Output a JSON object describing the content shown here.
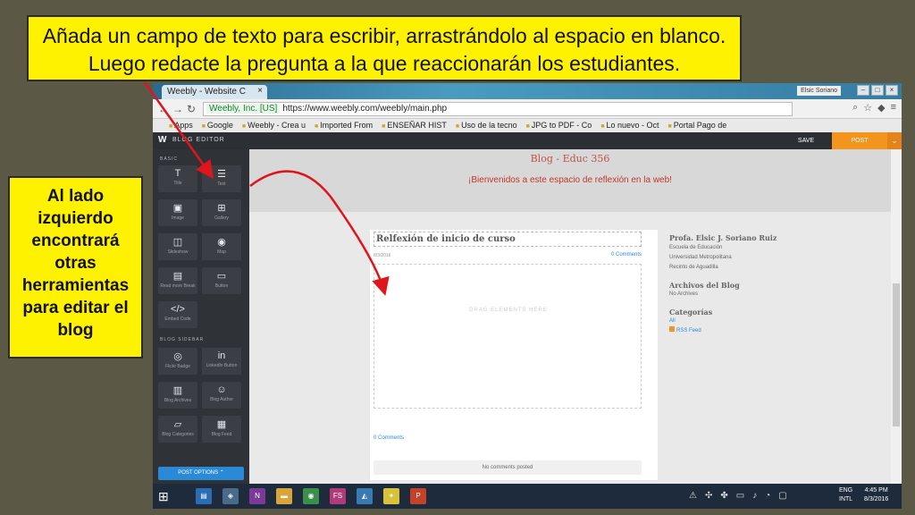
{
  "callouts": {
    "top_line1": "Añada un campo de texto para escribir, arrastrándolo al espacio en blanco.",
    "top_line2": "Luego redacte la pregunta a la que reaccionarán los estudiantes.",
    "left": "Al lado izquierdo encontrará otras herramientas para editar el blog"
  },
  "browser": {
    "tab_title": "Weebly - Website C",
    "user": "Elsic Soriano",
    "secure_label": "Weebly, Inc. [US]",
    "url": "https://www.weebly.com/weebly/main.php",
    "bookmarks": [
      "Apps",
      "Google",
      "Weebly - Crea u",
      "Imported From",
      "ENSEÑAR HIST",
      "Uso de la tecno",
      "JPG to PDF - Co",
      "Lo nuevo - Oct",
      "Portal Pago de"
    ]
  },
  "editor": {
    "title": "BLOG EDITOR",
    "save": "SAVE",
    "post": "POST",
    "sections": {
      "basic": "BASIC",
      "sidebar": "BLOG SIDEBAR"
    },
    "basic_tools": [
      {
        "label": "Title",
        "icon": "T"
      },
      {
        "label": "Text",
        "icon": "☰"
      },
      {
        "label": "Image",
        "icon": "▣"
      },
      {
        "label": "Gallery",
        "icon": "⊞"
      },
      {
        "label": "Slideshow",
        "icon": "◫"
      },
      {
        "label": "Map",
        "icon": "◉"
      },
      {
        "label": "Read more Break",
        "icon": "▤"
      },
      {
        "label": "Button",
        "icon": "▭"
      },
      {
        "label": "Embed Code",
        "icon": "</>"
      }
    ],
    "sidebar_tools": [
      {
        "label": "Flickr Badge",
        "icon": "◎"
      },
      {
        "label": "LinkedIn Button",
        "icon": "in"
      },
      {
        "label": "Blog Archives",
        "icon": "▥"
      },
      {
        "label": "Blog Author",
        "icon": "☺"
      },
      {
        "label": "Blog Categories",
        "icon": "▱"
      },
      {
        "label": "Blog Feed",
        "icon": "▦"
      }
    ],
    "post_options": "POST OPTIONS"
  },
  "blog": {
    "name": "Blog - Educ 356",
    "welcome": "¡Bienvenidos a este espacio de reflexión en la web!",
    "post_title": "Relfexión de inicio de curso",
    "post_date": "8/3/2016",
    "comments": "0 Comments",
    "drag_label": "DRAG ELEMENTS HERE",
    "no_comments": "No comments posted",
    "author_name": "Profa. Elsic J. Soriano Ruiz",
    "author_lines": [
      "Escuela de Educación",
      "Universidad Metropolitana",
      "Recinto de Aguadilla"
    ],
    "archives_heading": "Archivos del Blog",
    "archives_value": "No Archives",
    "categories_heading": "Categorías",
    "categories_all": "All",
    "rss": "RSS Feed"
  },
  "taskbar": {
    "lang1": "ENG",
    "lang2": "INTL",
    "time": "4:45 PM",
    "date": "8/3/2016"
  },
  "colors": {
    "callout_yellow": "#fff200",
    "post_orange": "#f3941d",
    "arrow_red": "#e0141b"
  }
}
